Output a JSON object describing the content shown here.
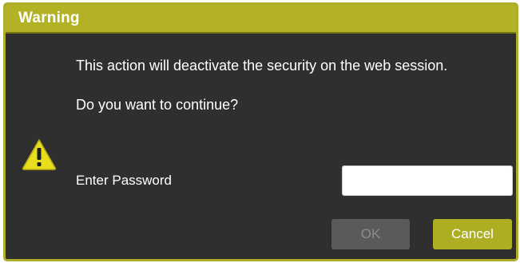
{
  "dialog": {
    "title": "Warning",
    "message_line1": "This action will deactivate the security on the web session.",
    "message_line2": "Do you want to continue?",
    "password_label": "Enter Password",
    "password_value": "",
    "password_placeholder": "",
    "ok_label": "OK",
    "cancel_label": "Cancel",
    "ok_enabled": false
  },
  "icons": {
    "warning": "warning-triangle-icon"
  },
  "colors": {
    "titlebar": "#b3b225",
    "border": "#aeae2a",
    "body": "#2f2f2f",
    "cancel_button": "#aeae22",
    "ok_button_disabled": "#5a5a5a",
    "warning_icon": "#e8de1e"
  }
}
